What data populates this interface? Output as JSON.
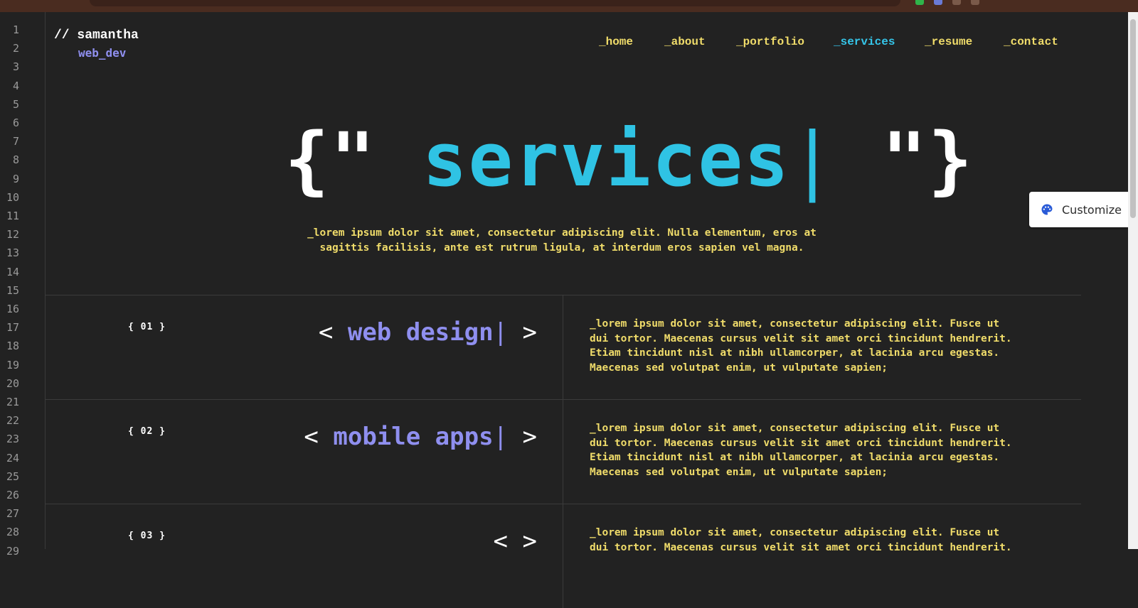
{
  "browser": {
    "extension_icons": [
      "green-extension-icon",
      "blue-extension-icon",
      "dark-extension-icon",
      "puzzle-extension-icon"
    ]
  },
  "gutter": {
    "line_numbers": [
      "1",
      "2",
      "3",
      "4",
      "5",
      "6",
      "7",
      "8",
      "9",
      "10",
      "11",
      "12",
      "13",
      "14",
      "15",
      "16",
      "17",
      "18",
      "19",
      "20",
      "21",
      "22",
      "23",
      "24",
      "25",
      "26",
      "27",
      "28",
      "29"
    ]
  },
  "logo": {
    "line1": "// samantha",
    "line2": "web_dev"
  },
  "nav": {
    "items": [
      {
        "label": "_home",
        "active": false
      },
      {
        "label": "_about",
        "active": false
      },
      {
        "label": "_portfolio",
        "active": false
      },
      {
        "label": "_services",
        "active": true
      },
      {
        "label": "_resume",
        "active": false
      },
      {
        "label": "_contact",
        "active": false
      }
    ]
  },
  "hero": {
    "open": "{\"",
    "word": "services",
    "cursor": "|",
    "close": "\"}"
  },
  "intro": {
    "text": "_lorem ipsum dolor sit amet, consectetur adipiscing elit. Nulla elementum, eros at sagittis facilisis, ante est rutrum ligula, at interdum eros sapien vel magna."
  },
  "services": [
    {
      "number": "{ 01 }",
      "chev_open": "<",
      "title": "web design",
      "cursor": "|",
      "chev_close": ">",
      "description": "_lorem ipsum dolor sit amet, consectetur adipiscing elit. Fusce ut dui tortor. Maecenas cursus velit sit amet orci tincidunt hendrerit. Etiam tincidunt nisl at nibh ullamcorper, at lacinia arcu egestas. Maecenas sed volutpat enim, ut vulputate sapien;"
    },
    {
      "number": "{ 02 }",
      "chev_open": "<",
      "title": "mobile apps",
      "cursor": "|",
      "chev_close": ">",
      "description": "_lorem ipsum dolor sit amet, consectetur adipiscing elit. Fusce ut dui tortor. Maecenas cursus velit sit amet orci tincidunt hendrerit. Etiam tincidunt nisl at nibh ullamcorper, at lacinia arcu egestas. Maecenas sed volutpat enim, ut vulputate sapien;"
    },
    {
      "number": "{ 03 }",
      "chev_open": "<",
      "title": "",
      "cursor": "",
      "chev_close": ">",
      "description": "_lorem ipsum dolor sit amet, consectetur adipiscing elit. Fusce ut dui tortor. Maecenas cursus velit sit amet orci tincidunt hendrerit."
    }
  ],
  "customize": {
    "label": "Customize",
    "icon": "palette-icon"
  },
  "colors": {
    "background": "#222222",
    "accent_cyan": "#2fc3e4",
    "accent_purple": "#8f8fef",
    "accent_yellow": "#f0dc6a"
  }
}
